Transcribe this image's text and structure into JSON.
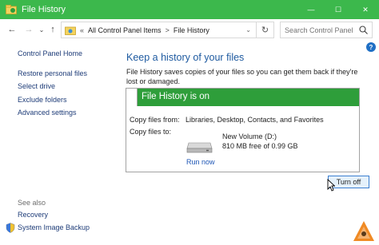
{
  "window": {
    "title": "File History",
    "controls": {
      "minimize": "—",
      "maximize": "☐",
      "close": "✕"
    }
  },
  "addressbar": {
    "back": "←",
    "forward": "→",
    "recent": "⌄",
    "up": "↑",
    "overflow": "«",
    "breadcrumbs": [
      "All Control Panel Items",
      "File History"
    ],
    "separator": ">",
    "dropdown": "⌄",
    "refresh": "↻",
    "search_placeholder": "Search Control Panel"
  },
  "help": "?",
  "sidebar": {
    "items": [
      {
        "label": "Control Panel Home"
      },
      {
        "label": "Restore personal files"
      },
      {
        "label": "Select drive"
      },
      {
        "label": "Exclude folders"
      },
      {
        "label": "Advanced settings"
      }
    ],
    "see_also_label": "See also",
    "see_also_items": [
      {
        "label": "Recovery"
      },
      {
        "label": "System Image Backup"
      }
    ]
  },
  "main": {
    "heading": "Keep a history of your files",
    "description": "File History saves copies of your files so you can get them back if they're lost or damaged.",
    "status_title": "File History is on",
    "copy_from_label": "Copy files from:",
    "copy_from_value": "Libraries, Desktop, Contacts, and Favorites",
    "copy_to_label": "Copy files to:",
    "drive_name": "New Volume (D:)",
    "drive_free": "810 MB free of 0.99 GB",
    "run_now": "Run now",
    "turn_off": "Turn off"
  },
  "colors": {
    "titlebar": "#3cb84c",
    "status_header": "#2e9e3a",
    "link": "#1e3c78",
    "heading": "#1e5aa0",
    "button_border": "#3c7fd0"
  }
}
